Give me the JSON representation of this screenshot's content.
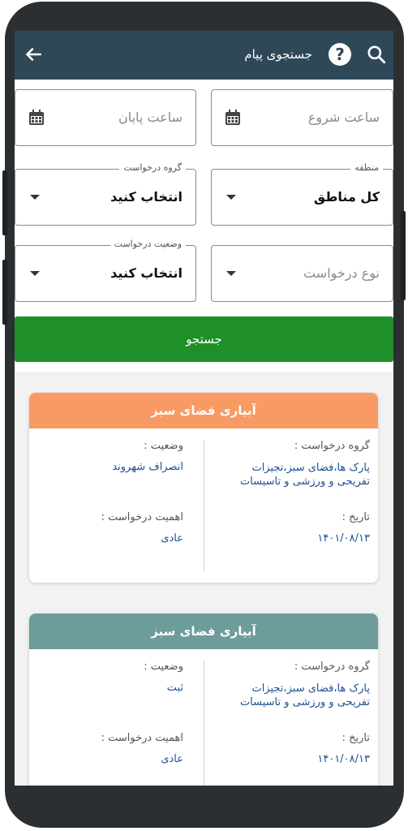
{
  "header": {
    "title": "جستجوی پیام",
    "help_symbol": "?",
    "icons": [
      "back-arrow-icon",
      "help-icon",
      "search-icon"
    ]
  },
  "form": {
    "start_time_placeholder": "ساعت شروع",
    "end_time_placeholder": "ساعت پایان",
    "region_label": "منطقه",
    "region_value": "کل مناطق",
    "group_label": "گروه درخواست",
    "group_value": "انتخاب کنید",
    "type_placeholder": "نوع درخواست",
    "status_label": "وضعیت درخواست",
    "status_value": "انتخاب کنید",
    "search_button": "جستجو"
  },
  "labels": {
    "group": "گروه درخواست :",
    "status": "وضعیت :",
    "date": "تاریخ :",
    "importance": "اهمیت درخواست :"
  },
  "results": [
    {
      "title": "آبیاری فضای سبز",
      "header_color": "#f79a63",
      "group_line1": "پارک ها،فضای سبز،تجیزات",
      "group_line2": "تفریحی و ورزشی و تاسیسات",
      "status": "انصراف شهروند",
      "date": "۱۴۰۱/۰۸/۱۳",
      "importance": "عادی"
    },
    {
      "title": "آبیاری فضای سبز",
      "header_color": "#6d9c9a",
      "group_line1": "پارک ها،فضای سبز،تجیزات",
      "group_line2": "تفریحی و ورزشی و تاسیسات",
      "status": "ثبت",
      "date": "۱۴۰۱/۰۸/۱۳",
      "importance": "عادی"
    }
  ],
  "colors": {
    "appbar": "#2f4858",
    "search_button": "#1f8f2a",
    "value_text": "#1d4f95"
  }
}
